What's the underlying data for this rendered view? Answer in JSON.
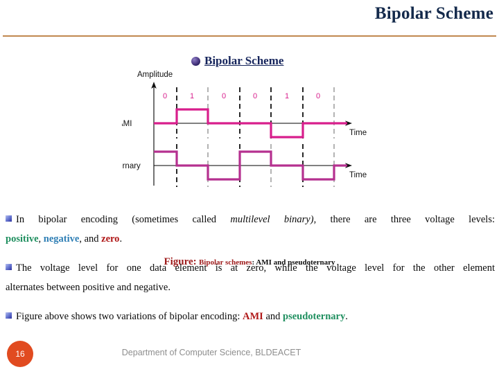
{
  "header": {
    "title": "Bipolar Scheme",
    "rule_color": "#c0884f",
    "title_color": "#13294b"
  },
  "heading": {
    "bullet_icon": "sphere-bullet-icon",
    "text": "Bipolar Scheme"
  },
  "figure": {
    "caption_figure": "Figure:",
    "caption_red": "Bipolar schemes",
    "caption_black": ": AMI and pseudoternary",
    "amplitude_label": "Amplitude",
    "ami_label": "AMI",
    "pseudoternary_label": "Pseudoternary",
    "time_label_ami": "Time",
    "time_label_pseudo": "Time",
    "signal_color": "#d81e8c",
    "bit_label_color": "#d81e8c"
  },
  "chart_data": {
    "type": "line",
    "title": "Bipolar schemes: AMI and pseudoternary",
    "xlabel": "Time",
    "ylabel": "Amplitude",
    "categories": [
      "0",
      "1",
      "0",
      "0",
      "1",
      "0"
    ],
    "series": [
      {
        "name": "AMI",
        "values": [
          0,
          1,
          0,
          0,
          -1,
          0
        ]
      },
      {
        "name": "Pseudoternary",
        "values": [
          1,
          0,
          -1,
          1,
          0,
          -1
        ]
      }
    ],
    "ylim": [
      -1,
      1
    ],
    "grid": false,
    "legend": "none",
    "annotations": [
      "Dashed vertical lines mark bit boundaries"
    ]
  },
  "body": {
    "p1_line1_a": "In bipolar encoding (sometimes called ",
    "p1_line1_italic": "multilevel binary)",
    "p1_line1_b": ", there are three voltage levels:",
    "p1_line2_positive": "positive",
    "p1_line2_sep1": ", ",
    "p1_line2_negative": "negative",
    "p1_line2_sep2": ", and ",
    "p1_line2_zero": "zero",
    "p1_line2_end": ".",
    "p2_line1": "The voltage level for one data element is at zero, while the voltage level for the other element",
    "p2_line2": "alternates between positive and negative.",
    "p3_a": "Figure above shows two variations of bipolar encoding: ",
    "p3_ami": "AMI",
    "p3_b": " and ",
    "p3_pseudo": "pseudoternary",
    "p3_end": "."
  },
  "footer": {
    "page_number": "16",
    "department": "Department of Computer Science, BLDEACET",
    "badge_color": "#e14b20"
  }
}
